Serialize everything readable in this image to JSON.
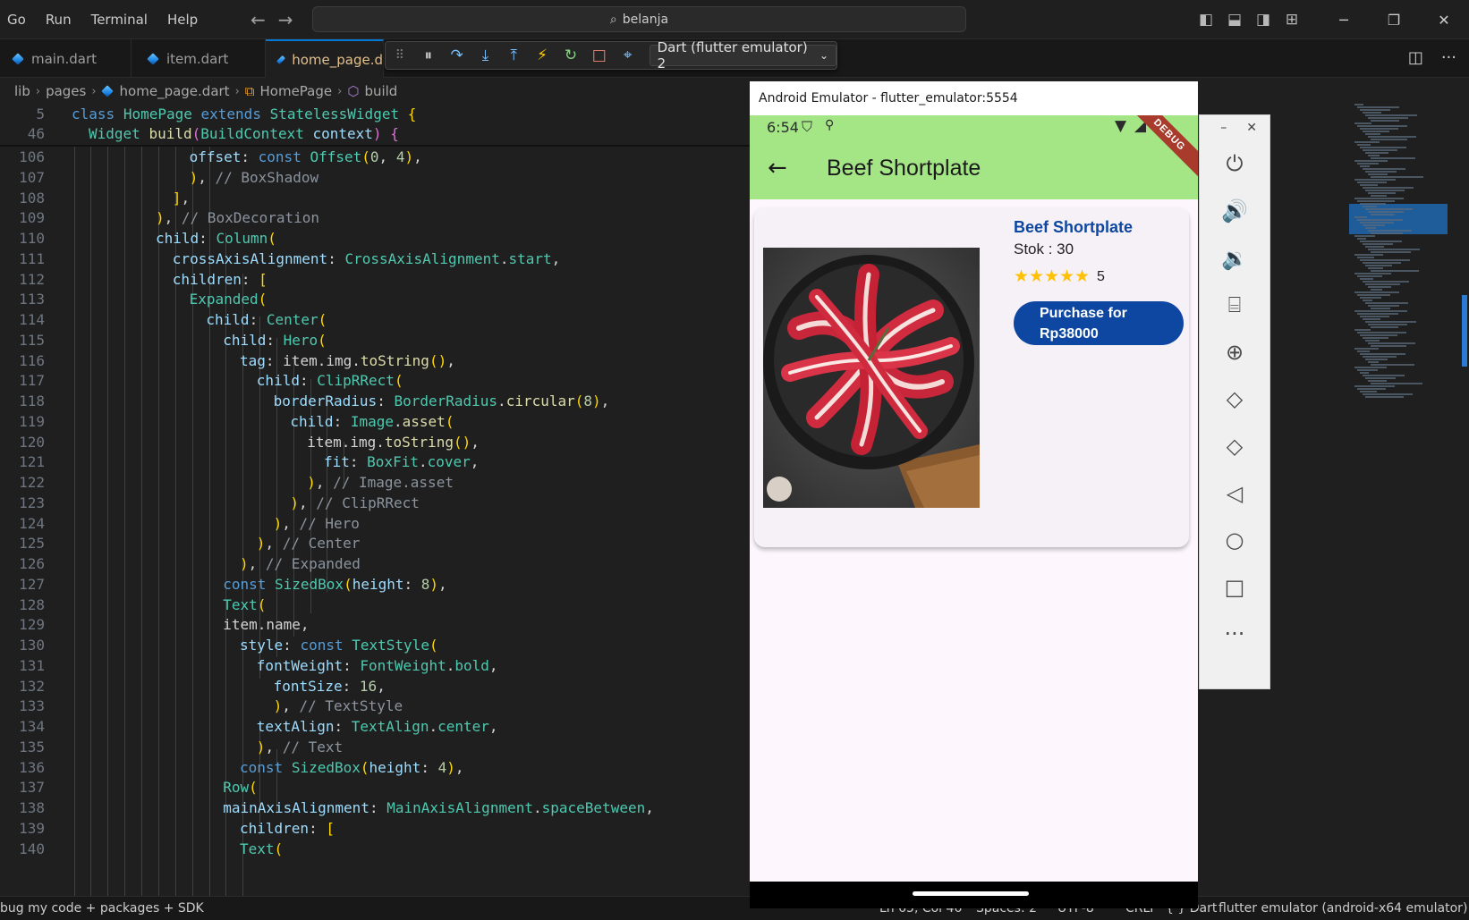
{
  "menu": [
    "Go",
    "Run",
    "Terminal",
    "Help"
  ],
  "search": {
    "text": "belanja"
  },
  "tabs": [
    {
      "label": "main.dart"
    },
    {
      "label": "item.dart"
    },
    {
      "label": "home_page.d"
    }
  ],
  "debug_toolbar": {
    "target": "Dart (flutter emulator) 2"
  },
  "breadcrumb": [
    "lib",
    "pages",
    "home_page.dart",
    "HomePage",
    "build"
  ],
  "sticky_lines": [
    {
      "num": "5",
      "text": "class HomePage extends StatelessWidget {"
    },
    {
      "num": "46",
      "text": "Widget build(BuildContext context) {"
    }
  ],
  "code_lines": [
    {
      "num": "106",
      "text": "offset: const Offset(0, 4),"
    },
    {
      "num": "107",
      "text": "), // BoxShadow"
    },
    {
      "num": "108",
      "text": "],"
    },
    {
      "num": "109",
      "text": "), // BoxDecoration"
    },
    {
      "num": "110",
      "text": "child: Column("
    },
    {
      "num": "111",
      "text": "crossAxisAlignment: CrossAxisAlignment.start,"
    },
    {
      "num": "112",
      "text": "children: ["
    },
    {
      "num": "113",
      "text": "Expanded("
    },
    {
      "num": "114",
      "text": "child: Center("
    },
    {
      "num": "115",
      "text": "child: Hero("
    },
    {
      "num": "116",
      "text": "tag: item.img.toString(),"
    },
    {
      "num": "117",
      "text": "child: ClipRRect("
    },
    {
      "num": "118",
      "text": "borderRadius: BorderRadius.circular(8),"
    },
    {
      "num": "119",
      "text": "child: Image.asset("
    },
    {
      "num": "120",
      "text": "item.img.toString(),"
    },
    {
      "num": "121",
      "text": "fit: BoxFit.cover,"
    },
    {
      "num": "122",
      "text": "), // Image.asset"
    },
    {
      "num": "123",
      "text": "), // ClipRRect"
    },
    {
      "num": "124",
      "text": "), // Hero"
    },
    {
      "num": "125",
      "text": "), // Center"
    },
    {
      "num": "126",
      "text": "), // Expanded"
    },
    {
      "num": "127",
      "text": "const SizedBox(height: 8),"
    },
    {
      "num": "128",
      "text": "Text("
    },
    {
      "num": "129",
      "text": "item.name,"
    },
    {
      "num": "130",
      "text": "style: const TextStyle("
    },
    {
      "num": "131",
      "text": "fontWeight: FontWeight.bold,"
    },
    {
      "num": "132",
      "text": "fontSize: 16,"
    },
    {
      "num": "133",
      "text": "), // TextStyle"
    },
    {
      "num": "134",
      "text": "textAlign: TextAlign.center,"
    },
    {
      "num": "135",
      "text": "), // Text"
    },
    {
      "num": "136",
      "text": "const SizedBox(height: 4),"
    },
    {
      "num": "137",
      "text": "Row("
    },
    {
      "num": "138",
      "text": "mainAxisAlignment: MainAxisAlignment.spaceBetween,"
    },
    {
      "num": "139",
      "text": "children: ["
    },
    {
      "num": "140",
      "text": "Text("
    }
  ],
  "statusbar": {
    "left": "bug my code + packages + SDK",
    "position": "Ln 65, Col 46",
    "spaces": "Spaces: 2",
    "encoding": "UTF-8",
    "eol": "CRLF",
    "language": "{ } Dart",
    "device": "flutter emulator (android-x64 emulator)"
  },
  "emulator": {
    "window_title": "Android Emulator - flutter_emulator:5554",
    "time": "6:54",
    "debug_banner": "DEBUG",
    "appbar_title": "Beef Shortplate",
    "item": {
      "name": "Beef Shortplate",
      "stock": "Stok : 30",
      "rating": "5",
      "stars": 5,
      "button": "Purchase for Rp38000"
    }
  },
  "colors": {
    "appbar": "#a4e686",
    "accent": "#0d47a1",
    "star": "#ffc107",
    "vscode_accent": "#0078d4"
  }
}
